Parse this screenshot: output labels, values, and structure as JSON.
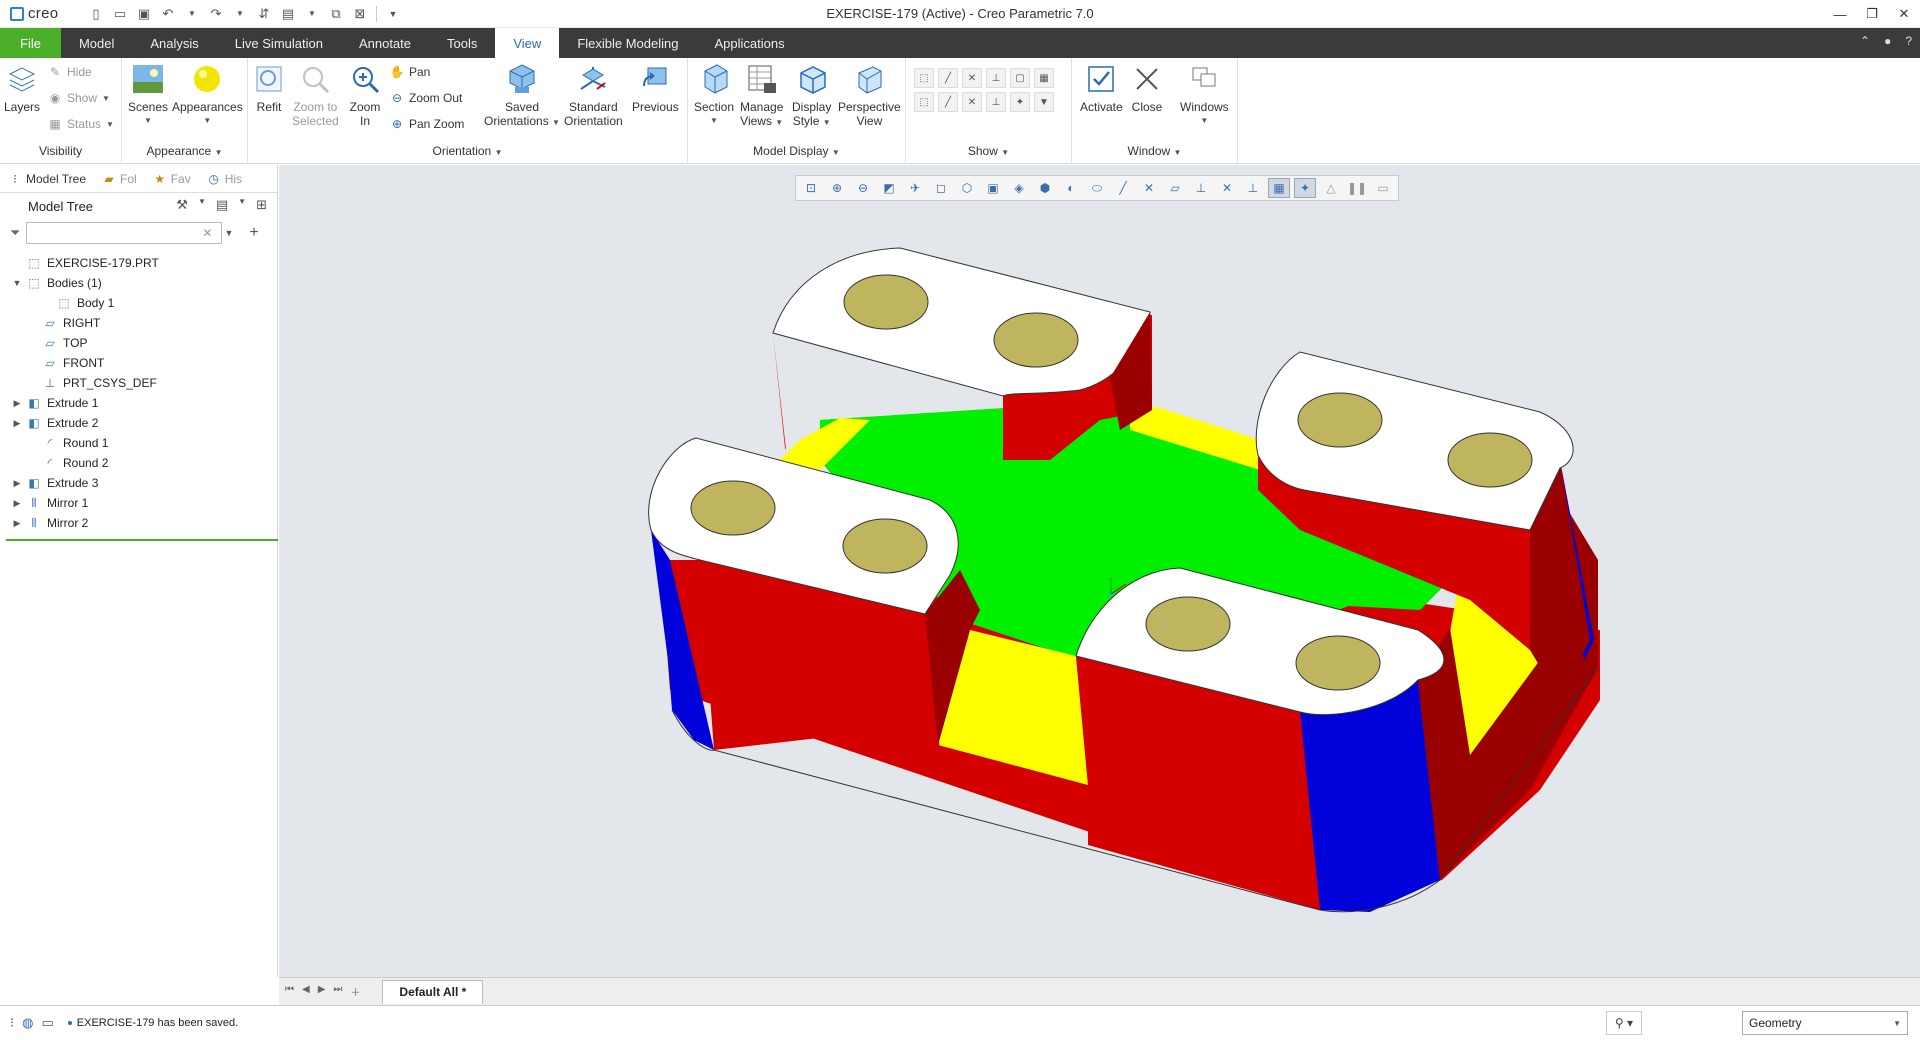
{
  "app": {
    "logo_text": "creo",
    "window_title": "EXERCISE-179 (Active) - Creo Parametric 7.0"
  },
  "tabs": [
    {
      "label": "File"
    },
    {
      "label": "Model"
    },
    {
      "label": "Analysis"
    },
    {
      "label": "Live Simulation"
    },
    {
      "label": "Annotate"
    },
    {
      "label": "Tools"
    },
    {
      "label": "View"
    },
    {
      "label": "Flexible Modeling"
    },
    {
      "label": "Applications"
    }
  ],
  "ribbon": {
    "visibility": {
      "title": "Visibility",
      "layers": "Layers",
      "hide": "Hide",
      "show": "Show",
      "status": "Status"
    },
    "appearance": {
      "title": "Appearance",
      "scenes": "Scenes",
      "appearances": "Appearances"
    },
    "orientation": {
      "title": "Orientation",
      "refit": "Refit",
      "zoom_selected_1": "Zoom to",
      "zoom_selected_2": "Selected",
      "zoom_in_1": "Zoom",
      "zoom_in_2": "In",
      "pan": "Pan",
      "zoom_out": "Zoom Out",
      "pan_zoom": "Pan Zoom",
      "saved_1": "Saved",
      "saved_2": "Orientations",
      "standard_1": "Standard",
      "standard_2": "Orientation",
      "previous": "Previous"
    },
    "model_display": {
      "title": "Model Display",
      "section": "Section",
      "manage_1": "Manage",
      "manage_2": "Views",
      "display_1": "Display",
      "display_2": "Style",
      "perspective_1": "Perspective",
      "perspective_2": "View"
    },
    "show": {
      "title": "Show"
    },
    "window": {
      "title": "Window",
      "activate": "Activate",
      "close": "Close",
      "windows": "Windows"
    }
  },
  "left_panel": {
    "tabs": [
      {
        "label": "Model Tree"
      },
      {
        "label": "Fol"
      },
      {
        "label": "Fav"
      },
      {
        "label": "His"
      }
    ],
    "header": "Model Tree",
    "search_value": "",
    "tree": [
      {
        "label": "EXERCISE-179.PRT",
        "icon": "part-icon",
        "toggle": ""
      },
      {
        "label": "Bodies (1)",
        "icon": "bodies-icon",
        "toggle": "▼"
      },
      {
        "label": "Body 1",
        "icon": "body-icon",
        "toggle": ""
      },
      {
        "label": "RIGHT",
        "icon": "datum-plane-icon",
        "toggle": ""
      },
      {
        "label": "TOP",
        "icon": "datum-plane-icon",
        "toggle": ""
      },
      {
        "label": "FRONT",
        "icon": "datum-plane-icon",
        "toggle": ""
      },
      {
        "label": "PRT_CSYS_DEF",
        "icon": "csys-icon",
        "toggle": ""
      },
      {
        "label": "Extrude 1",
        "icon": "extrude-icon",
        "toggle": "▶"
      },
      {
        "label": "Extrude 2",
        "icon": "extrude-icon",
        "toggle": "▶"
      },
      {
        "label": "Round 1",
        "icon": "round-icon",
        "toggle": ""
      },
      {
        "label": "Round 2",
        "icon": "round-icon",
        "toggle": ""
      },
      {
        "label": "Extrude 3",
        "icon": "extrude-icon",
        "toggle": "▶"
      },
      {
        "label": "Mirror 1",
        "icon": "mirror-icon",
        "toggle": "▶"
      },
      {
        "label": "Mirror 2",
        "icon": "mirror-icon",
        "toggle": "▶"
      }
    ]
  },
  "viewport": {
    "bottom_tab": "Default All *"
  },
  "status": {
    "message": "EXERCISE-179 has been saved.",
    "filter_value": "Geometry"
  },
  "colors": {
    "file_tab": "#4caf2a",
    "tab_bar": "#3b3b3b",
    "active_tab_text": "#2a6bb5",
    "viewport_bg": "#e3e6ea",
    "model_red": "#d40000",
    "model_green": "#00f000",
    "model_yellow": "#ffff00",
    "model_blue": "#0000d8"
  }
}
